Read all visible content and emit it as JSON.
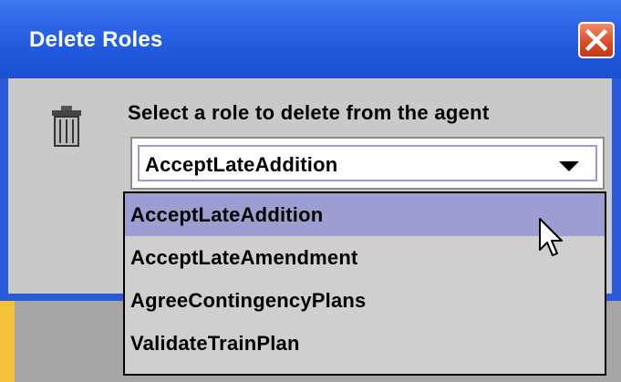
{
  "dialog": {
    "title": "Delete Roles",
    "prompt": "Select a role to delete from the agent",
    "combo": {
      "selected": "AcceptLateAddition"
    },
    "dropdown": {
      "items": [
        {
          "label": "AcceptLateAddition",
          "selected": true
        },
        {
          "label": "AcceptLateAmendment",
          "selected": false
        },
        {
          "label": "AgreeContingencyPlans",
          "selected": false
        },
        {
          "label": "ValidateTrainPlan",
          "selected": false
        }
      ]
    }
  },
  "icons": [
    "trash-icon",
    "close-icon",
    "chevron-down-icon",
    "mouse-cursor-icon"
  ],
  "colors": {
    "titlebar": "#2b64e6",
    "close": "#d94a25",
    "panel": "#c9c9c9",
    "selection": "#9c9dd0"
  }
}
